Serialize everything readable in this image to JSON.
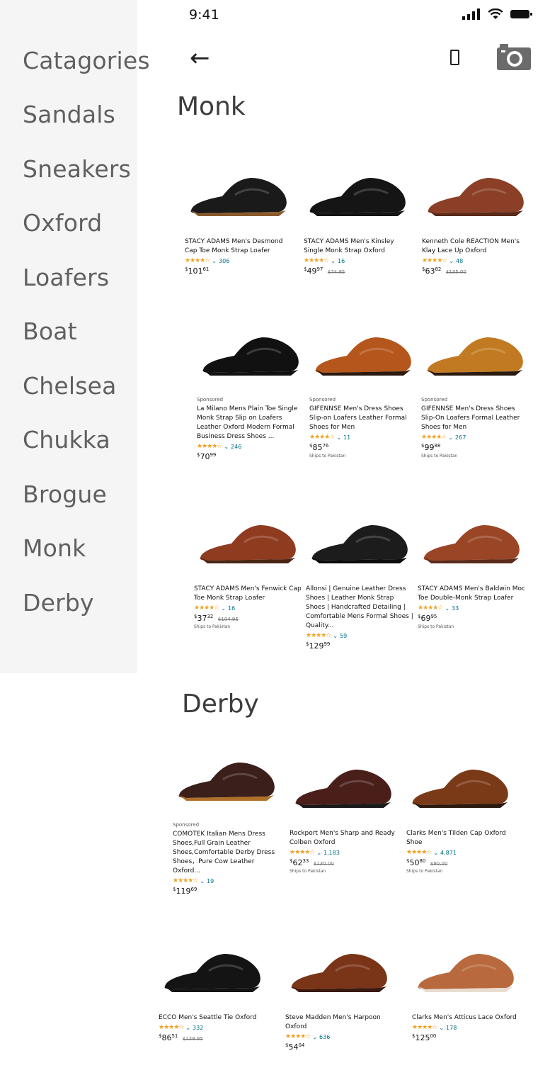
{
  "status_bar": {
    "time": "9:41"
  },
  "sidebar": {
    "items": [
      {
        "label": "Catagories"
      },
      {
        "label": "Sandals"
      },
      {
        "label": "Sneakers"
      },
      {
        "label": "Oxford"
      },
      {
        "label": "Loafers"
      },
      {
        "label": "Boat"
      },
      {
        "label": "Chelsea"
      },
      {
        "label": "Chukka"
      },
      {
        "label": "Brogue"
      },
      {
        "label": "Monk"
      },
      {
        "label": "Derby"
      }
    ]
  },
  "header": {
    "back_icon": "←",
    "phone_icon": "phone-icon",
    "camera_icon": "camera-icon"
  },
  "sections": {
    "monk": {
      "title": "Monk",
      "products": [
        {
          "title": "STACY ADAMS Men's Desmond Cap Toe Monk Strap Loafer",
          "reviews": "306",
          "price_whole": "101",
          "price_frac": "61",
          "old": "",
          "sponsored": "",
          "ships": "",
          "color": "#1a1a1a",
          "sole": "#8b5a2b"
        },
        {
          "title": "STACY ADAMS Men's Kinsley Single Monk Strap Oxford",
          "reviews": "16",
          "price_whole": "49",
          "price_frac": "97",
          "old": "$74.95",
          "sponsored": "",
          "ships": "",
          "color": "#151515",
          "sole": "#151515"
        },
        {
          "title": "Kenneth Cole REACTION Men's Klay Lace Up Oxford",
          "reviews": "48",
          "price_whole": "63",
          "price_frac": "82",
          "old": "$135.00",
          "sponsored": "",
          "ships": "",
          "color": "#8a3f26",
          "sole": "#5a2a1a"
        },
        {
          "title": "La Milano Mens Plain Toe Single Monk Strap Slip on Loafers Leather Oxford Modern Formal Business Dress Shoes ...",
          "reviews": "246",
          "price_whole": "70",
          "price_frac": "99",
          "old": "",
          "sponsored": "Sponsored",
          "ships": "",
          "color": "#111111",
          "sole": "#111111"
        },
        {
          "title": "GIFENNSE Men's Dress Shoes Slip-on Loafers Leather Formal Shoes for Men",
          "reviews": "11",
          "price_whole": "85",
          "price_frac": "76",
          "old": "",
          "sponsored": "Sponsored",
          "ships": "Ships to Pakistan",
          "color": "#b5561c",
          "sole": "#2a1a10"
        },
        {
          "title": "GIFENNSE Men's Dress Shoes Slip-On Loafers Formal Leather Shoes for Men",
          "reviews": "267",
          "price_whole": "99",
          "price_frac": "88",
          "old": "",
          "sponsored": "Sponsored",
          "ships": "Ships to Pakistan",
          "color": "#c27a22",
          "sole": "#2a1a10"
        },
        {
          "title": "STACY ADAMS Men's Fenwick Cap Toe Monk Strap Loafer",
          "reviews": "16",
          "price_whole": "37",
          "price_frac": "32",
          "old": "$104.95",
          "sponsored": "",
          "ships": "Ships to Pakistan",
          "color": "#8e3b20",
          "sole": "#4a2514"
        },
        {
          "title": "Allonsi | Genuine Leather Dress Shoes | Leather Monk Strap Shoes | Handcrafted Detailing | Comfortable Mens Formal Shoes | Quality...",
          "reviews": "59",
          "price_whole": "129",
          "price_frac": "99",
          "old": "",
          "sponsored": "",
          "ships": "",
          "color": "#1c1c1c",
          "sole": "#0c0c0c"
        },
        {
          "title": "STACY ADAMS Men's Baldwin Moc Toe Double-Monk Strap Loafer",
          "reviews": "33",
          "price_whole": "69",
          "price_frac": "95",
          "old": "",
          "sponsored": "",
          "ships": "Ships to Pakistan",
          "color": "#9a4526",
          "sole": "#5a2a1a"
        }
      ]
    },
    "derby": {
      "title": "Derby",
      "products": [
        {
          "title": "COMOTEK Italian Mens Dress Shoes,Full Grain Leather Shoes,Comfortable Derby Dress Shoes，Pure Cow Leather Oxford...",
          "reviews": "19",
          "price_whole": "119",
          "price_frac": "69",
          "old": "",
          "sponsored": "Sponsored",
          "ships": "",
          "color": "#3a1f1a",
          "sole": "#b0702a"
        },
        {
          "title": "Rockport Men's Sharp and Ready Colben Oxford",
          "reviews": "1,183",
          "price_whole": "62",
          "price_frac": "33",
          "old": "$130.00",
          "sponsored": "",
          "ships": "Ships to Pakistan",
          "color": "#4a1f1a",
          "sole": "#1a1a1a"
        },
        {
          "title": "Clarks Men's Tilden Cap Oxford Shoe",
          "reviews": "4,871",
          "price_whole": "50",
          "price_frac": "80",
          "old": "$90.00",
          "sponsored": "",
          "ships": "Ships to Pakistan",
          "color": "#7a3a18",
          "sole": "#2a1a10"
        },
        {
          "title": "ECCO Men's Seattle Tie Oxford",
          "reviews": "332",
          "price_whole": "86",
          "price_frac": "51",
          "old": "$129.95",
          "sponsored": "",
          "ships": "",
          "color": "#141414",
          "sole": "#141414"
        },
        {
          "title": "Steve Madden Men's Harpoon Oxford",
          "reviews": "636",
          "price_whole": "54",
          "price_frac": "04",
          "old": "",
          "sponsored": "",
          "ships": "",
          "color": "#7a3418",
          "sole": "#3a1a10"
        },
        {
          "title": "Clarks Men's Atticus Lace Oxford",
          "reviews": "178",
          "price_whole": "125",
          "price_frac": "00",
          "old": "",
          "sponsored": "",
          "ships": "",
          "color": "#b86a3e",
          "sole": "#e8ddd0"
        }
      ]
    }
  },
  "currency": "$",
  "stars_glyph": "★★★★☆"
}
